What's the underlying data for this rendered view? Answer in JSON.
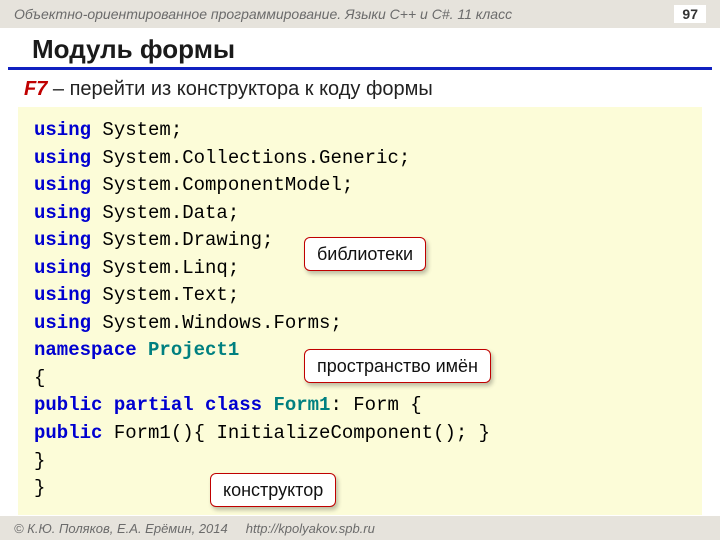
{
  "header": {
    "course": "Объектно-ориентированное программирование. Языки C++ и C#. 11 класс",
    "page": "97"
  },
  "title": "Модуль формы",
  "subtitle": {
    "key": "F7",
    "rest": " – перейти из конструктора к коду формы"
  },
  "code": {
    "lines": [
      {
        "kw": "using",
        "rest": " System;"
      },
      {
        "kw": "using",
        "rest": " System.Collections.Generic;"
      },
      {
        "kw": "using",
        "rest": " System.ComponentModel;"
      },
      {
        "kw": "using",
        "rest": " System.Data;"
      },
      {
        "kw": "using",
        "rest": " System.Drawing;"
      },
      {
        "kw": "using",
        "rest": " System.Linq;"
      },
      {
        "kw": "using",
        "rest": " System.Text;"
      },
      {
        "kw": "using",
        "rest": " System.Windows.Forms;"
      },
      {
        "kw": "namespace",
        "ns": " Project1",
        "rest": ""
      },
      {
        "plain": "{"
      },
      {
        "indent": " ",
        "kw": "public partial class",
        "cls": " Form1",
        "rest": ": Form  {"
      },
      {
        "indent": "   ",
        "kw": "public",
        "rest": " Form1(){ InitializeComponent(); }"
      },
      {
        "indent": "   ",
        "plain": "}"
      },
      {
        "plain": "}"
      }
    ]
  },
  "callouts": {
    "libraries": "библиотеки",
    "namespace": "пространство имён",
    "constructor": "конструктор"
  },
  "footer": {
    "copyright": "© К.Ю. Поляков, Е.А. Ерёмин, 2014",
    "url": "http://kpolyakov.spb.ru"
  }
}
